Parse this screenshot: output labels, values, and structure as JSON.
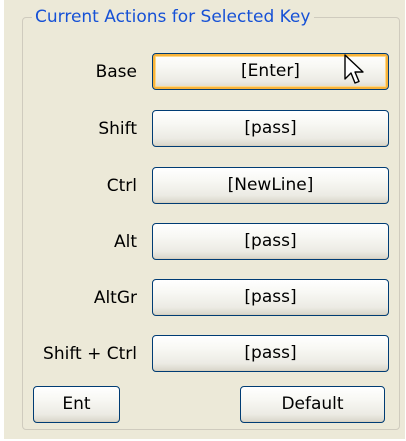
{
  "group_title": "Current Actions for Selected Key",
  "rows": [
    {
      "label": "Base",
      "action": "[Enter]"
    },
    {
      "label": "Shift",
      "action": "[pass]"
    },
    {
      "label": "Ctrl",
      "action": "[NewLine]"
    },
    {
      "label": "Alt",
      "action": "[pass]"
    },
    {
      "label": "AltGr",
      "action": "[pass]"
    },
    {
      "label": "Shift + Ctrl",
      "action": "[pass]"
    }
  ],
  "buttons": {
    "key_name": "Ent",
    "default": "Default"
  },
  "colors": {
    "panel_background": "#ece9d8",
    "group_title": "#1651d6",
    "button_border": "#003c74",
    "hover_highlight": "#f8b33a"
  },
  "cursor_icon": "arrow-pointer-icon"
}
